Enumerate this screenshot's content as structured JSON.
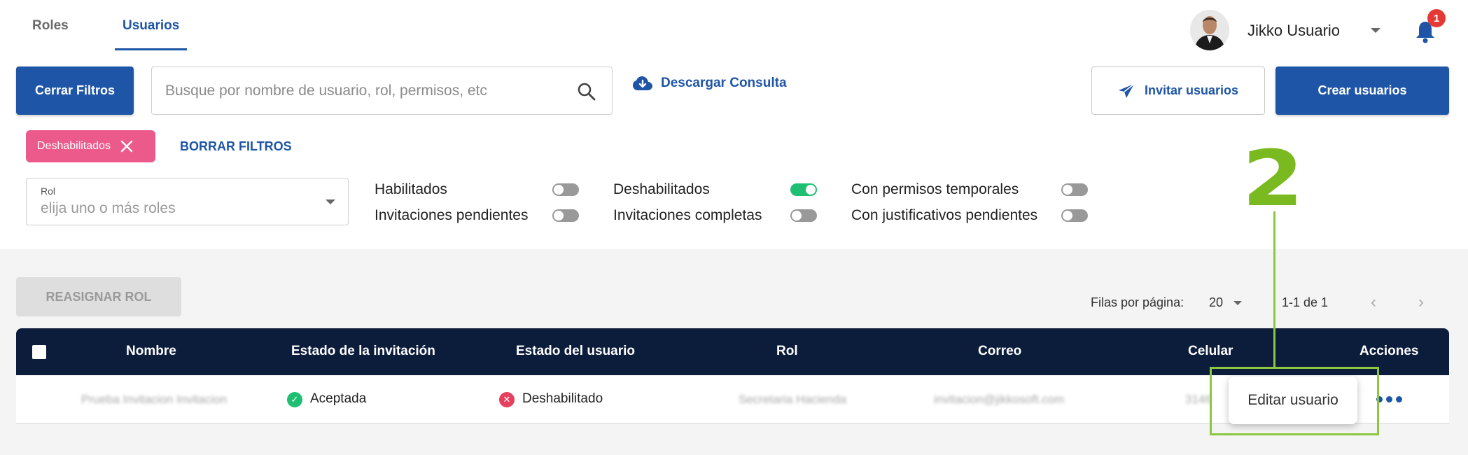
{
  "tabs": [
    {
      "label": "Roles",
      "active": false
    },
    {
      "label": "Usuarios",
      "active": true
    }
  ],
  "user": {
    "name": "Jikko Usuario",
    "notification_count": "1"
  },
  "toolbar": {
    "close_filters_label": "Cerrar Filtros",
    "search_placeholder": "Busque por nombre de usuario, rol, permisos, etc",
    "download_label": "Descargar Consulta",
    "invite_label": "Invitar usuarios",
    "create_label": "Crear usuarios"
  },
  "filters": {
    "active_chip": "Deshabilitados",
    "clear_label": "BORRAR FILTROS",
    "role": {
      "label": "Rol",
      "placeholder": "elija uno o más roles"
    },
    "toggles": [
      {
        "label": "Habilitados",
        "on": false
      },
      {
        "label": "Invitaciones pendientes",
        "on": false
      },
      {
        "label": "Deshabilitados",
        "on": true
      },
      {
        "label": "Invitaciones completas",
        "on": false
      },
      {
        "label": "Con permisos temporales",
        "on": false
      },
      {
        "label": "Con justificativos pendientes",
        "on": false
      }
    ]
  },
  "table_controls": {
    "reassign_label": "REASIGNAR ROL",
    "rows_per_page_label": "Filas por página:",
    "rows_per_page_value": "20",
    "range_label": "1-1 de 1"
  },
  "table": {
    "headers": [
      "Nombre",
      "Estado de la invitación",
      "Estado del usuario",
      "Rol",
      "Correo",
      "Celular",
      "Acciones"
    ],
    "rows": [
      {
        "nombre": "Prueba Invitacion Invitacion",
        "estado_invitacion": "Aceptada",
        "estado_usuario": "Deshabilitado",
        "rol": "Secretaria Hacienda",
        "correo": "invitacion@jikkosoft.com",
        "celular": "3146"
      }
    ]
  },
  "action_menu": {
    "item": "Editar usuario"
  },
  "annotation": {
    "step": "2"
  },
  "colors": {
    "primary": "#1e55a6",
    "header_dark": "#0c1c3b",
    "chip": "#ec5a8c",
    "toggle_on": "#1fbf73",
    "annotation": "#8dc63f"
  }
}
